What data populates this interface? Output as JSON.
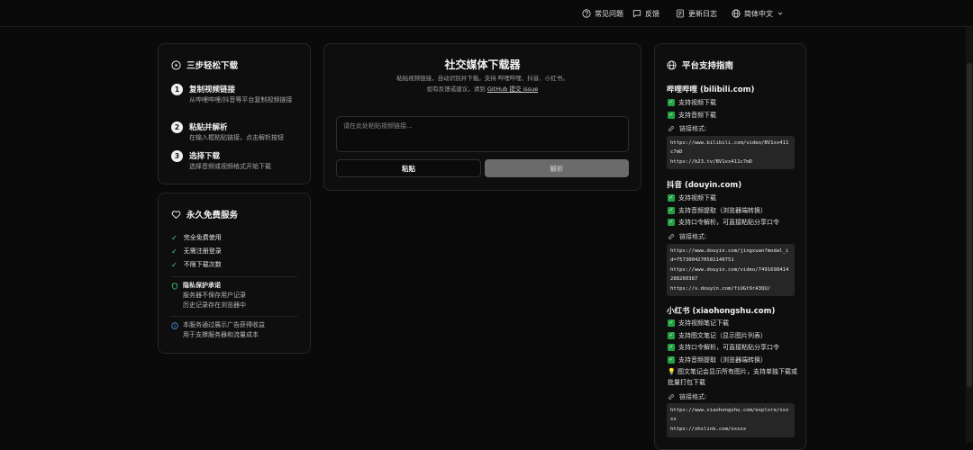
{
  "nav": {
    "faq": "常见问题",
    "feedback": "反馈",
    "changelog": "更新日志",
    "language": "简体中文"
  },
  "steps_card": {
    "title": "三步轻松下载",
    "steps": [
      {
        "num": "1",
        "title": "复制视频链接",
        "desc": "从哔哩哔哩/抖音等平台复制视频链接"
      },
      {
        "num": "2",
        "title": "粘贴并解析",
        "desc": "在输入框粘贴链接，点击解析按钮"
      },
      {
        "num": "3",
        "title": "选择下载",
        "desc": "选择音频或视频格式开始下载"
      }
    ]
  },
  "free_card": {
    "title": "永久免费服务",
    "items": [
      "完全免费使用",
      "无需注册登录",
      "不限下载次数"
    ],
    "privacy_title": "隐私保护承诺",
    "privacy_lines": [
      "服务器不保存用户记录",
      "历史记录存在浏览器中"
    ],
    "ad_lines": [
      "本服务通过展示广告获得收益",
      "用于支撑服务器和流量成本"
    ]
  },
  "main": {
    "title": "社交媒体下载器",
    "subtitle": "粘贴视频链接，自动识别并下载。支持 哔哩哔哩、抖音、小红书。",
    "feedback_prefix": "如有反馈或建议，请到 ",
    "feedback_link": "GitHub 提交 issue",
    "input_placeholder": "请在此处粘贴视频链接...",
    "paste_button": "粘贴",
    "parse_button": "解析"
  },
  "guide": {
    "title": "平台支持指南",
    "format_label": "链接格式:",
    "platforms": [
      {
        "name": "哔哩哔哩 (bilibili.com)",
        "features": [
          "支持视频下载",
          "支持音频下载"
        ],
        "links": [
          "https://www.bilibili.com/video/BV1xx411c7mD",
          "https://b23.tv/BV1xx411c7mD"
        ]
      },
      {
        "name": "抖音 (douyin.com)",
        "features": [
          "支持视频下载",
          "支持音频提取（浏览器端转换）",
          "支持口令解析，可直接粘贴分享口令"
        ],
        "links": [
          "https://www.douyin.com/jingxuan?modal_id=7573004270581140751",
          "https://www.douyin.com/video/7491698414288260387",
          "https://v.douyin.com/fiUGt9rA3QU/"
        ]
      },
      {
        "name": "小红书 (xiaohongshu.com)",
        "features": [
          "支持视频笔记下载",
          "支持图文笔记（显示图片列表）",
          "支持口令解析，可直接粘贴分享口令",
          "支持音频提取（浏览器端转换）"
        ],
        "tip": "💡 图文笔记会显示所有图片，支持单独下载或批量打包下载",
        "links": [
          "https://www.xiaohongshu.com/explore/xxxxx",
          "https://xhslink.com/xxxxx"
        ]
      }
    ]
  }
}
